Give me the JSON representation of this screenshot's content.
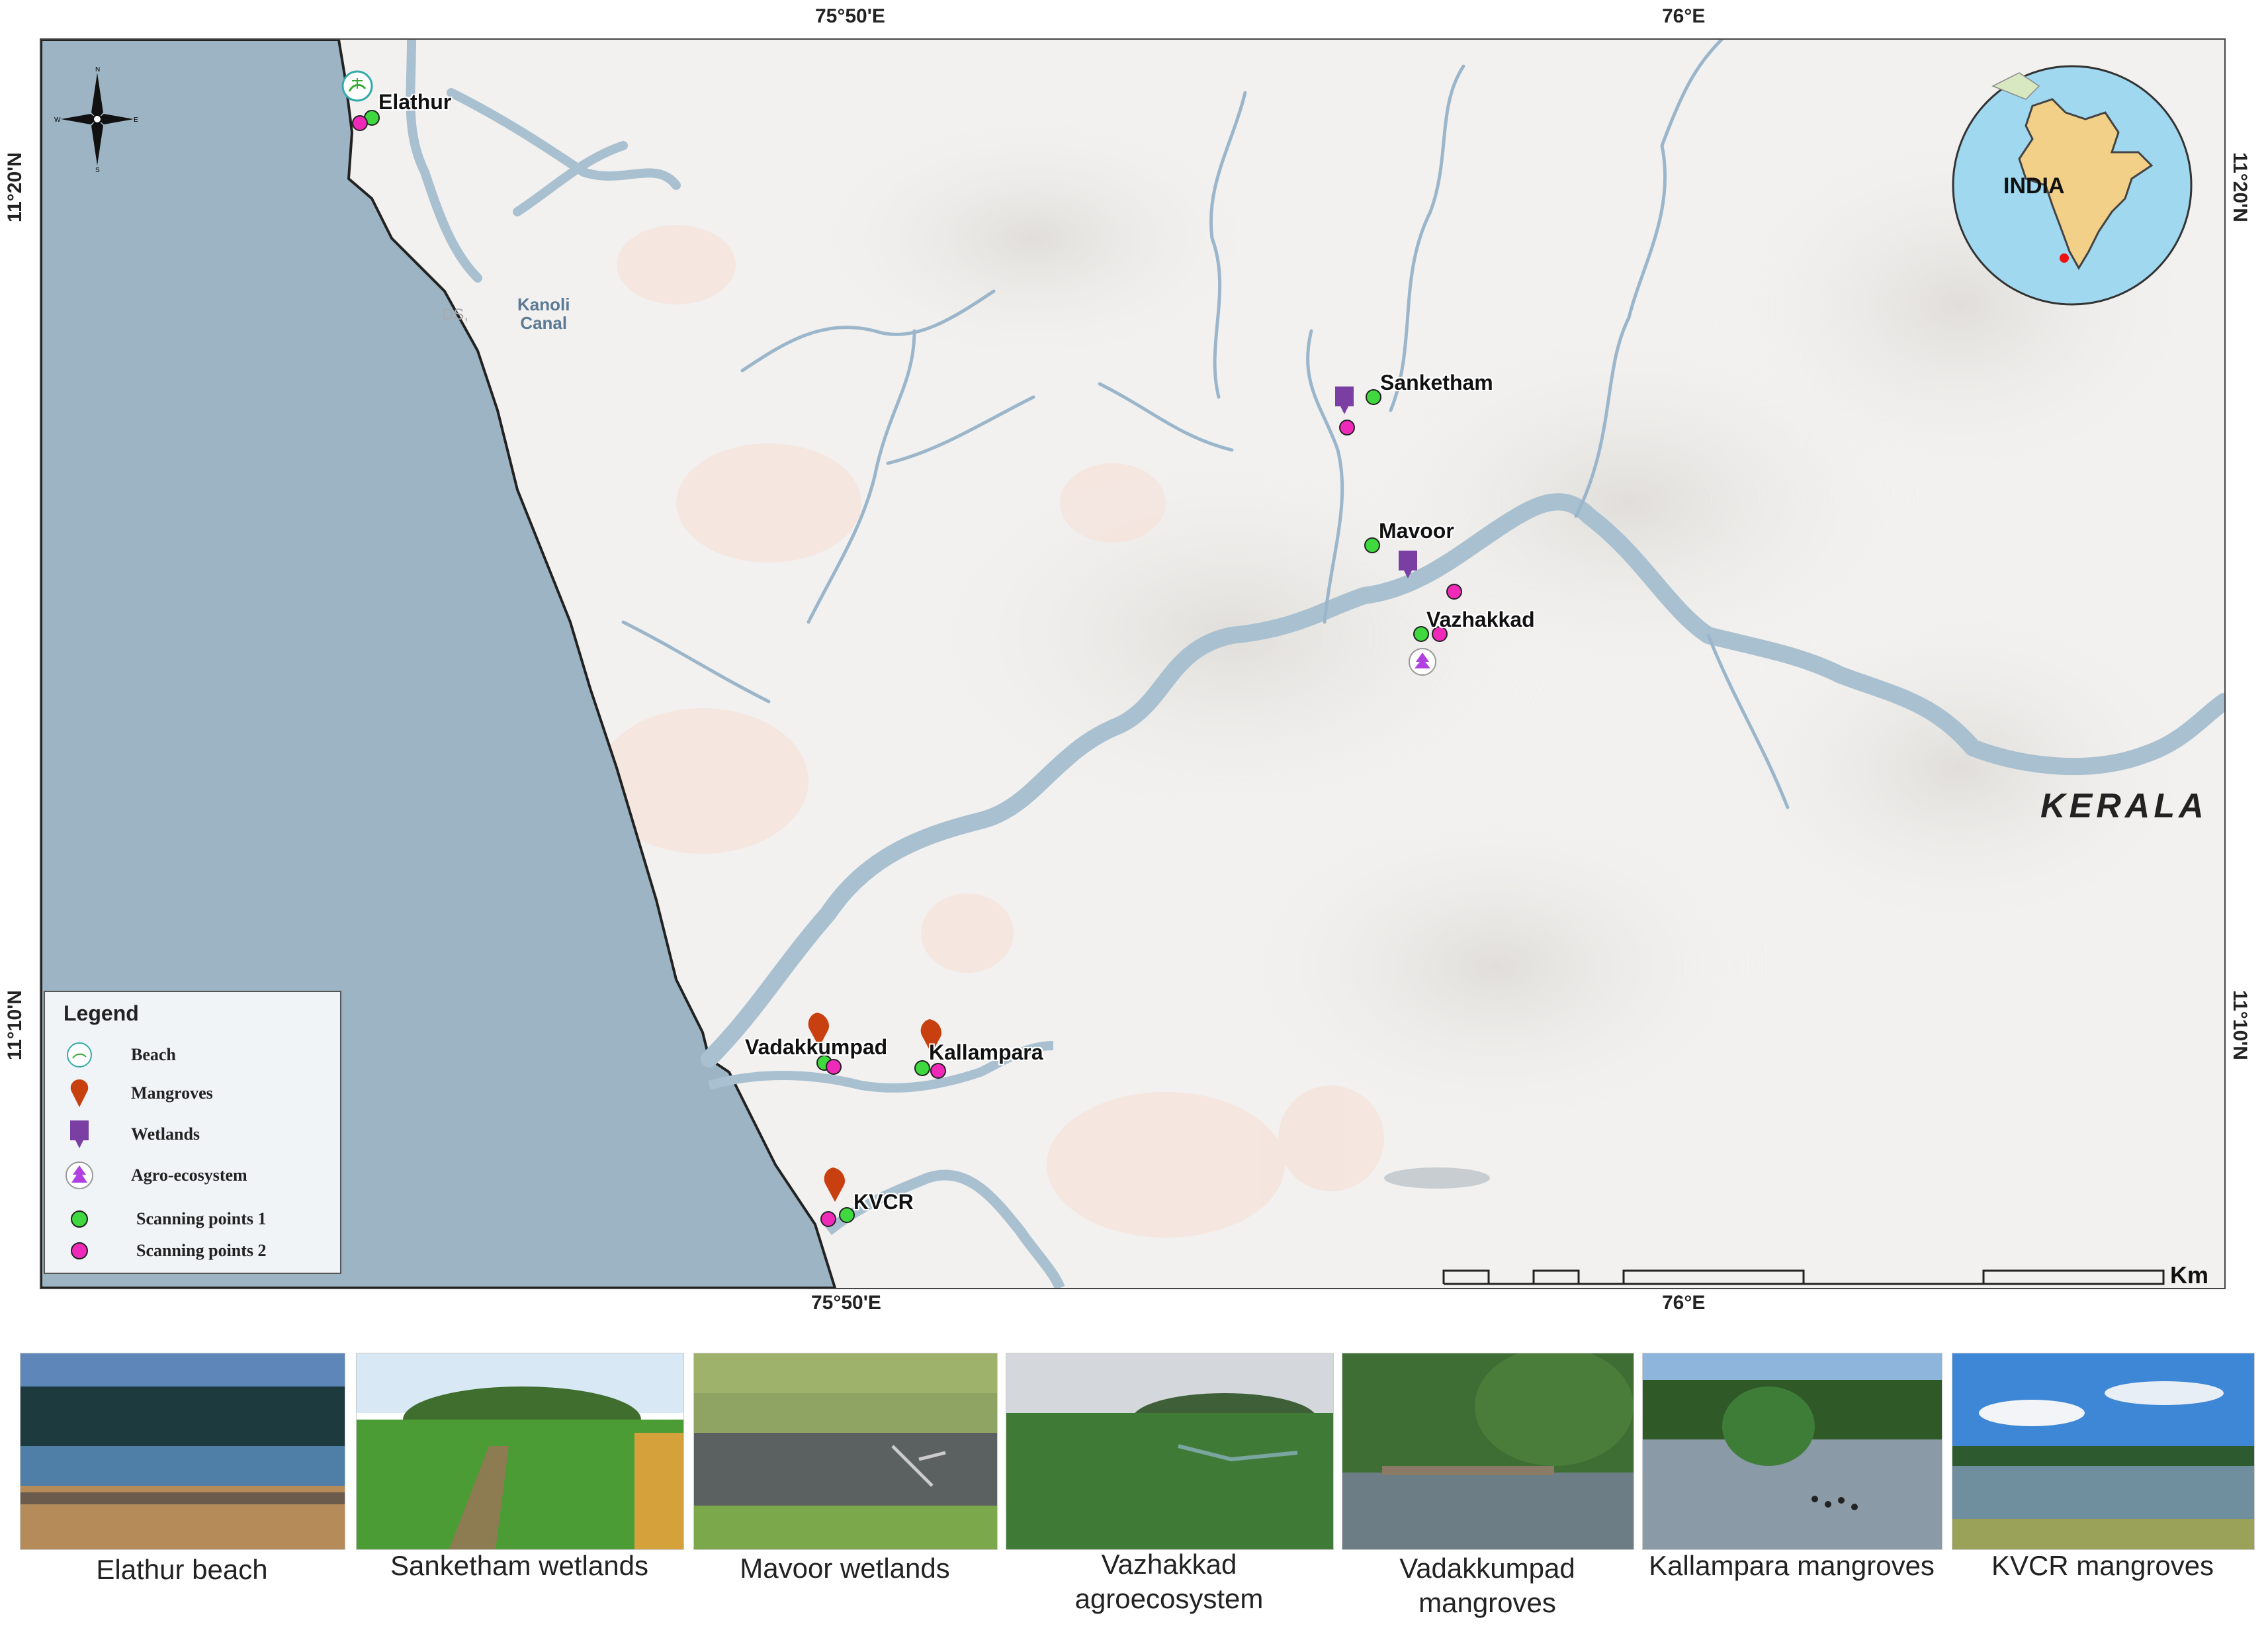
{
  "graticule": {
    "top": [
      "75°50'E",
      "76°E"
    ],
    "bottom": [
      "75°50'E",
      "76°E"
    ],
    "left": [
      "11°20'N",
      "11°10'N"
    ],
    "right": [
      "11°20'N",
      "11°10'N"
    ]
  },
  "map": {
    "region_label": "KERALA",
    "water_label": "Kanoli\nCanal",
    "faint_label": "DS,",
    "inset_label": "INDIA",
    "colors": {
      "sea": "#9db4c4",
      "land": "#f2f1ef",
      "river": "#a9c0d0",
      "stream": "#9bb6cb",
      "scan1": "#3fd83f",
      "scan2": "#f02ab8",
      "mangrove": "#c8400f",
      "wetland": "#7b3fa3",
      "agro": "#b040e0"
    },
    "sites": [
      {
        "name": "Elathur",
        "type": "Beach"
      },
      {
        "name": "Sanketham",
        "type": "Wetlands"
      },
      {
        "name": "Mavoor",
        "type": "Wetlands"
      },
      {
        "name": "Vazhakkad",
        "type": "Agro-ecosystem"
      },
      {
        "name": "Vadakkumpad",
        "type": "Mangroves"
      },
      {
        "name": "Kallampara",
        "type": "Mangroves"
      },
      {
        "name": "KVCR",
        "type": "Mangroves"
      }
    ]
  },
  "legend": {
    "title": "Legend",
    "items": [
      {
        "label": "Beach",
        "icon": "beach-icon"
      },
      {
        "label": "Mangroves",
        "icon": "mangrove-pin-icon"
      },
      {
        "label": "Wetlands",
        "icon": "wetland-marker-icon"
      },
      {
        "label": "Agro-ecosystem",
        "icon": "tree-icon"
      },
      {
        "label": "Scanning points 1",
        "icon": "green-dot-icon"
      },
      {
        "label": "Scanning points 2",
        "icon": "magenta-dot-icon"
      }
    ]
  },
  "scale_bar": {
    "unit": "Km",
    "ticks": [
      "0",
      "2",
      "4",
      "8",
      "12",
      "16"
    ]
  },
  "photos": [
    {
      "caption": "Elathur beach"
    },
    {
      "caption": "Sanketham wetlands"
    },
    {
      "caption": "Mavoor wetlands"
    },
    {
      "caption": "Vazhakkad\nagroecosystem"
    },
    {
      "caption": "Vadakkumpad\nmangroves"
    },
    {
      "caption": "Kallampara mangroves"
    },
    {
      "caption": "KVCR mangroves"
    }
  ]
}
